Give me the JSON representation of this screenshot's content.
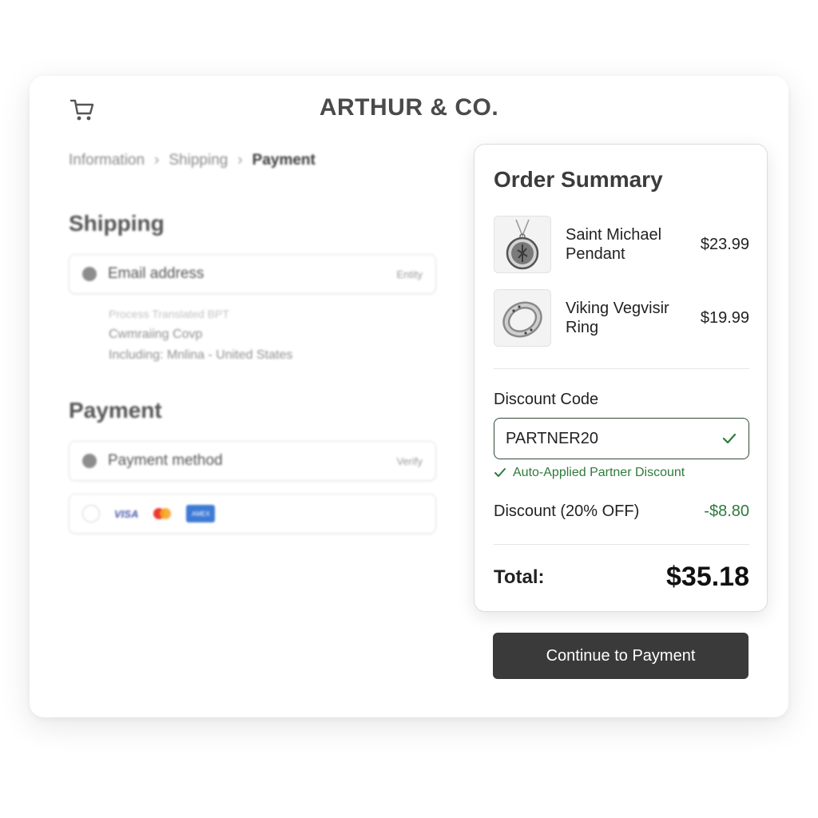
{
  "header": {
    "brand": "ARTHUR & CO.",
    "cart_icon": "cart-icon"
  },
  "breadcrumb": {
    "items": [
      "Information",
      "Shipping",
      "Payment"
    ],
    "current": "Payment"
  },
  "shipping": {
    "title": "Shipping",
    "field_label": "Email address",
    "field_action": "Entity",
    "sub_lines": [
      "Process Translated BPT",
      "Cwmraiing Covp",
      "Including: Mnlina - United States"
    ]
  },
  "payment": {
    "title": "Payment",
    "field_label": "Payment method",
    "field_action": "Verify",
    "cards": [
      "VISA",
      "mastercard",
      "AMEX"
    ]
  },
  "summary": {
    "title": "Order Summary",
    "items": [
      {
        "name": "Saint Michael Pendant",
        "price": "$23.99",
        "icon": "pendant-icon"
      },
      {
        "name": "Viking Vegvisir Ring",
        "price": "$19.99",
        "icon": "ring-icon"
      }
    ],
    "discount_label": "Discount Code",
    "discount_value": "PARTNER20",
    "applied_note": "Auto-Applied Partner Discount",
    "discount_row_label": "Discount (20% OFF)",
    "discount_row_amount": "-$8.80",
    "total_label": "Total:",
    "total_value": "$35.18"
  },
  "cta": {
    "label": "Continue to Payment"
  },
  "colors": {
    "accent_green": "#2f7a3a",
    "button_dark": "#3a3a3a",
    "input_border": "#2f4a36"
  }
}
